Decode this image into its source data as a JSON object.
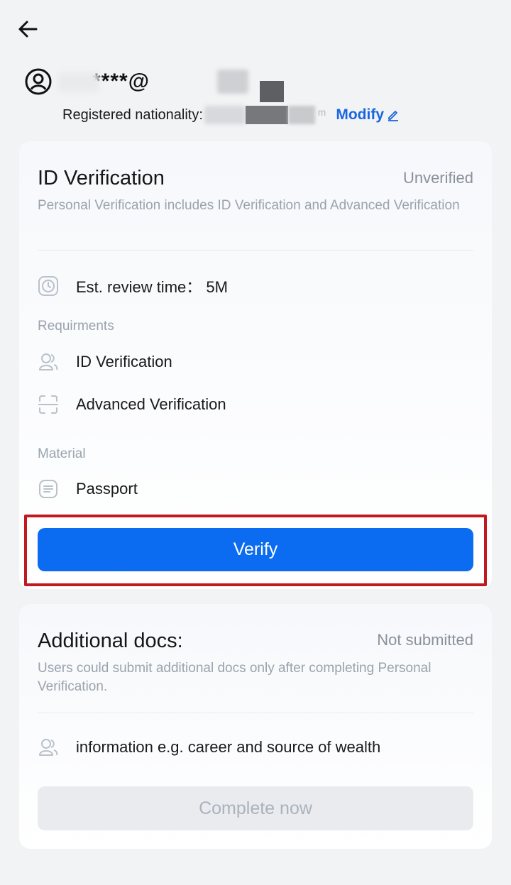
{
  "header": {
    "back_icon": "arrow-left-icon",
    "avatar_icon": "user-circle-icon",
    "email_masked": "****@",
    "nationality_label": "Registered nationality:",
    "nationality_tail": "ᵐ",
    "modify_label": "Modify",
    "modify_icon": "pencil-icon"
  },
  "id_card": {
    "title": "ID Verification",
    "status": "Unverified",
    "description": "Personal Verification includes ID Verification and Advanced Verification",
    "review_time": "Est. review time： 5M",
    "requirements_label": "Requirments",
    "requirements": [
      {
        "label": "ID Verification",
        "icon": "users-icon"
      },
      {
        "label": "Advanced Verification",
        "icon": "scan-frame-icon"
      }
    ],
    "material_label": "Material",
    "material": {
      "label": "Passport",
      "icon": "document-icon"
    },
    "verify_label": "Verify"
  },
  "docs_card": {
    "title": "Additional docs:",
    "status": "Not submitted",
    "description": "Users could submit additional docs only after completing Personal Verification.",
    "item": {
      "label": "information e.g. career and source of wealth",
      "icon": "users-icon"
    },
    "button_label": "Complete now"
  },
  "colors": {
    "accent": "#0b6cf2",
    "link": "#1a66e0",
    "highlight": "#c0191f",
    "muted_text": "#9aa3ad",
    "disabled_bg": "#e9ebee"
  }
}
